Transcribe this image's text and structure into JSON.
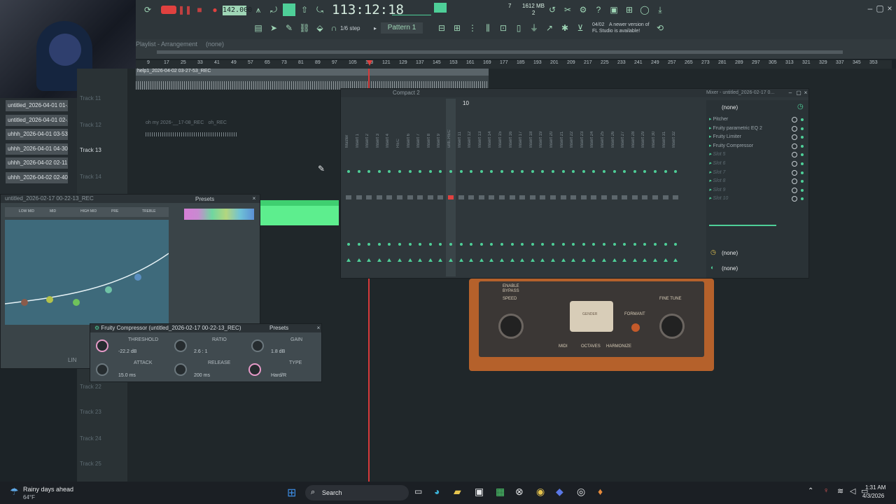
{
  "toolbar": {
    "tempo": "142.000",
    "time": "113:12:18",
    "memory": "1612 MB",
    "voices": "2",
    "cpu": "7",
    "step": "1/6 step",
    "pattern": "Pattern 1",
    "news_date": "04/02",
    "news_text": "A newer version of",
    "news_text2": "FL Studio is available!",
    "rec_label": "REC"
  },
  "playlist": {
    "title": "Playlist - Arrangement",
    "none": "(none)",
    "ruler": [
      "9",
      "17",
      "25",
      "33",
      "41",
      "49",
      "57",
      "65",
      "73",
      "81",
      "89",
      "97",
      "105",
      "113",
      "121",
      "129",
      "137",
      "145",
      "153",
      "161",
      "169",
      "177",
      "185",
      "193",
      "201",
      "209",
      "217",
      "225",
      "233",
      "241",
      "249",
      "257",
      "265",
      "273",
      "281",
      "289",
      "297",
      "305",
      "313",
      "321",
      "329",
      "337",
      "345",
      "353"
    ],
    "clip_name": "help1_2026-04-02 03-27-53_REC",
    "clip2_name": "oh my 2026-__17-08_REC",
    "clip3_name": "oh_REC",
    "tracks": [
      "Track 11",
      "Track 12",
      "Track 13",
      "Track 14",
      "Track 22",
      "Track 23",
      "Track 24",
      "Track 25"
    ],
    "files": [
      "untitled_2026-04-01 01-...",
      "untitled_2026-04-01 02-...",
      "uhhh_2026-04-01 03-53...",
      "uhhh_2026-04-01 04-30...",
      "uhhh_2026-04-02 02-11...",
      "uhhh_2026-04-02 02-40..."
    ]
  },
  "mixer": {
    "title": "Compact 2",
    "mixer_title": "Mixer - untitled_2026-02-17 0...",
    "selected": "10",
    "channels": [
      "Master",
      "Insert 1",
      "Insert 2",
      "Insert 3",
      "Insert 4",
      "REC",
      "Insert 6",
      "Insert 7",
      "Insert 8",
      "Insert 9",
      "unti..REC",
      "Insert 11",
      "Insert 12",
      "Insert 13",
      "Insert 14",
      "Insert 15",
      "Insert 16",
      "Insert 17",
      "Insert 18",
      "Insert 19",
      "Insert 20",
      "Insert 21",
      "Insert 22",
      "Insert 23",
      "Insert 24",
      "Insert 25",
      "Insert 26",
      "Insert 27",
      "Insert 28",
      "Insert 29",
      "Insert 30",
      "Insert 31",
      "Insert 32"
    ],
    "preset_none": "(none)",
    "slots": [
      "Pitcher",
      "Fruity parametric EQ 2",
      "Fruity Limiter",
      "Fruity Compressor",
      "Slot 5",
      "Slot 6",
      "Slot 7",
      "Slot 8",
      "Slot 9",
      "Slot 10"
    ],
    "eq_none": "(none)",
    "out_none": "(none)"
  },
  "eq": {
    "title": "untitled_2026-02-17 00-22-13_REC",
    "presets": "Presets",
    "band_labels": [
      "LOW MID",
      "MID",
      "HIGH MID",
      "PRE",
      "TREBLE"
    ],
    "lin": "LIN"
  },
  "compressor": {
    "title": "Fruity Compressor (untitled_2026-02-17 00-22-13_REC)",
    "presets": "Presets",
    "threshold_label": "THRESHOLD",
    "threshold": "-22.2 dB",
    "ratio_label": "RATIO",
    "ratio": "2.6 : 1",
    "gain_label": "GAIN",
    "gain": "1.8 dB",
    "attack_label": "ATTACK",
    "attack": "15.0 ms",
    "release_label": "RELEASE",
    "release": "200 ms",
    "type_label": "TYPE",
    "type": "Hard/R"
  },
  "pitcher": {
    "enable": "ENABLE",
    "bypass": "BYPASS",
    "speed": "SPEED",
    "formant": "FORMANT",
    "fine_tune": "FINE TUNE",
    "midi": "MIDI",
    "octaves": "OCTAVES",
    "harmonize": "HARMONIZE",
    "gender": "GENDER"
  },
  "taskbar": {
    "weather_title": "Rainy days ahead",
    "weather_temp": "64°F",
    "search": "Search",
    "time": "1:31 AM",
    "date": "4/3/2026"
  },
  "colors": {
    "accent": "#4ecf98",
    "bg": "#1c2327",
    "red": "#e0413f"
  }
}
